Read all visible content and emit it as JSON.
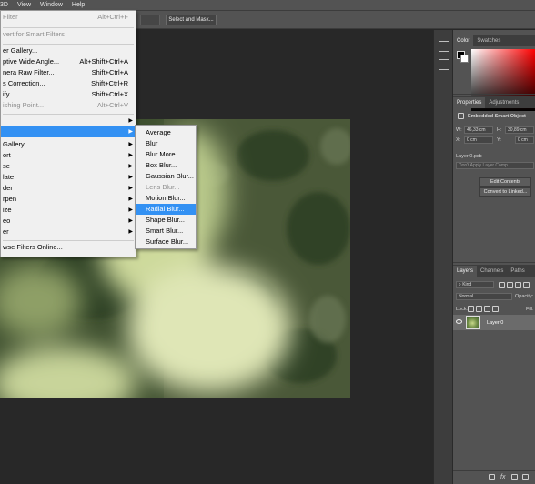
{
  "menubar": {
    "items": [
      "3D",
      "View",
      "Window",
      "Help"
    ]
  },
  "options_bar": {
    "select_mask": "Select and Mask..."
  },
  "filter_menu": {
    "items": [
      {
        "label": "Filter",
        "shortcut": "Alt+Ctrl+F",
        "disabled": true
      },
      {
        "label": "vert for Smart Filters",
        "shortcut": "",
        "disabled": true
      },
      {
        "label": "er Gallery...",
        "shortcut": "",
        "disabled": false
      },
      {
        "label": "ptive Wide Angle...",
        "shortcut": "Alt+Shift+Ctrl+A",
        "disabled": false
      },
      {
        "label": "nera Raw Filter...",
        "shortcut": "Shift+Ctrl+A",
        "disabled": false
      },
      {
        "label": "s Correction...",
        "shortcut": "Shift+Ctrl+R",
        "disabled": false
      },
      {
        "label": "ify...",
        "shortcut": "Shift+Ctrl+X",
        "disabled": false
      },
      {
        "label": "ishing Point...",
        "shortcut": "Alt+Ctrl+V",
        "disabled": true
      },
      {
        "label": "",
        "submenu": true
      },
      {
        "label": "",
        "submenu": true,
        "highlighted": true
      },
      {
        "label": "Gallery",
        "submenu": true
      },
      {
        "label": "ort",
        "submenu": true
      },
      {
        "label": "se",
        "submenu": true
      },
      {
        "label": "late",
        "submenu": true
      },
      {
        "label": "der",
        "submenu": true
      },
      {
        "label": "rpen",
        "submenu": true
      },
      {
        "label": "ize",
        "submenu": true
      },
      {
        "label": "eo",
        "submenu": true
      },
      {
        "label": "er",
        "submenu": true
      },
      {
        "label": "wse Filters Online...",
        "submenu": false
      }
    ]
  },
  "blur_menu": {
    "items": [
      {
        "label": "Average",
        "disabled": false
      },
      {
        "label": "Blur",
        "disabled": false
      },
      {
        "label": "Blur More",
        "disabled": false
      },
      {
        "label": "Box Blur...",
        "disabled": false
      },
      {
        "label": "Gaussian Blur...",
        "disabled": false
      },
      {
        "label": "Lens Blur...",
        "disabled": true
      },
      {
        "label": "Motion Blur...",
        "disabled": false
      },
      {
        "label": "Radial Blur...",
        "disabled": false,
        "highlighted": true
      },
      {
        "label": "Shape Blur...",
        "disabled": false
      },
      {
        "label": "Smart Blur...",
        "disabled": false
      },
      {
        "label": "Surface Blur...",
        "disabled": false
      }
    ]
  },
  "color_panel": {
    "tabs": [
      "Color",
      "Swatches"
    ]
  },
  "properties_panel": {
    "tabs": [
      "Properties",
      "Adjustments"
    ],
    "object_type": "Embedded Smart Object",
    "w_label": "W:",
    "w_value": "46,33 cm",
    "h_label": "H:",
    "h_value": "30,89 cm",
    "x_label": "X:",
    "x_value": "0 cm",
    "y_label": "Y:",
    "y_value": "0 cm",
    "filename": "Layer 0.psb",
    "comps": "Don't Apply Layer Comp",
    "edit_contents": "Edit Contents",
    "convert_linked": "Convert to Linked..."
  },
  "layers_panel": {
    "tabs": [
      "Layers",
      "Channels",
      "Paths"
    ],
    "kind": "Kind",
    "blend_mode": "Normal",
    "opacity_label": "Opacity:",
    "lock_label": "Lock:",
    "fill_label": "Fill:",
    "layer_name": "Layer 0",
    "footer_fx": "fx"
  }
}
